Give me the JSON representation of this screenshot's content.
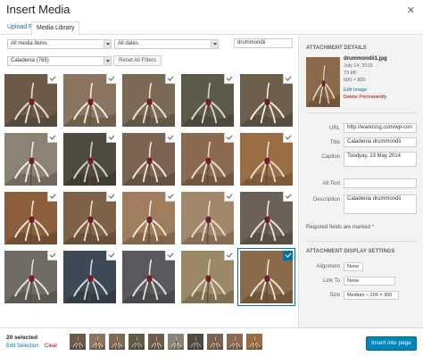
{
  "modal": {
    "title": "Insert Media",
    "tabs": [
      {
        "label": "Upload Files",
        "active": false
      },
      {
        "label": "Media Library",
        "active": true
      }
    ]
  },
  "filters": {
    "media_type": "All media items",
    "dates": "All dates",
    "category": "Caladenia (765)",
    "reset_label": "Reset All Filters",
    "search_value": "drummondii"
  },
  "grid": {
    "thumbnails": [
      {
        "bg": "#6b5a48",
        "fg": "#e8e2dc",
        "checked": true
      },
      {
        "bg": "#8a7560",
        "fg": "#f2ede6",
        "checked": true
      },
      {
        "bg": "#7b6a55",
        "fg": "#ece4da",
        "checked": true
      },
      {
        "bg": "#5c5a48",
        "fg": "#dcd8cf",
        "checked": true
      },
      {
        "bg": "#6d5e4c",
        "fg": "#f3eee8",
        "checked": true
      },
      {
        "bg": "#8a8374",
        "fg": "#f1ede8",
        "checked": true
      },
      {
        "bg": "#4f4a3f",
        "fg": "#d9d2c6",
        "checked": true
      },
      {
        "bg": "#7a6350",
        "fg": "#efe6dc",
        "checked": true
      },
      {
        "bg": "#8c6a50",
        "fg": "#e9dfd4",
        "checked": true
      },
      {
        "bg": "#9a6e45",
        "fg": "#eadbc9",
        "checked": true
      },
      {
        "bg": "#8b5f3c",
        "fg": "#f1e6d8",
        "checked": true
      },
      {
        "bg": "#7e6147",
        "fg": "#eae0d3",
        "checked": true
      },
      {
        "bg": "#a07c5c",
        "fg": "#f3ebe2",
        "checked": true
      },
      {
        "bg": "#a2876a",
        "fg": "#e8ddd0",
        "checked": true
      },
      {
        "bg": "#6c6156",
        "fg": "#ece6df",
        "checked": true
      },
      {
        "bg": "#6f6c66",
        "fg": "#e2dfdb",
        "checked": true
      },
      {
        "bg": "#3d4a55",
        "fg": "#d6d9dc",
        "checked": true
      },
      {
        "bg": "#5a5a5e",
        "fg": "#e4e4e6",
        "checked": true
      },
      {
        "bg": "#9a8866",
        "fg": "#e4dcc8",
        "checked": true
      },
      {
        "bg": "#8b6a4a",
        "fg": "#efe4d6",
        "checked": true,
        "active": true
      }
    ]
  },
  "details": {
    "heading": "Attachment Details",
    "filename": "drummondii1.jpg",
    "date": "July 14, 2015",
    "filesize": "73 kB",
    "dimensions": "600 × 800",
    "edit_link": "Edit Image",
    "delete_link": "Delete Permanently",
    "fields": {
      "url_label": "URL",
      "url_value": "http://wanoscg.com/wp-con",
      "title_label": "Title",
      "title_value": "Caladenia drummondii",
      "caption_label": "Caption",
      "caption_value": "Toodyay, 23 May 2014",
      "alt_label": "Alt Text",
      "alt_value": "",
      "description_label": "Description",
      "description_value": "Caladenia drummondii"
    },
    "required_note": "Required fields are marked",
    "required_star": "*"
  },
  "display_settings": {
    "heading": "Attachment Display Settings",
    "alignment_label": "Alignment",
    "alignment_value": "None",
    "link_label": "Link To",
    "link_value": "None",
    "size_label": "Size",
    "size_value": "Medium – 200 × 300"
  },
  "footer": {
    "selected_count": "20 selected",
    "edit_selection": "Edit Selection",
    "clear": "Clear",
    "insert_label": "Insert into page",
    "mini_count": 10
  },
  "colors": {
    "accent": "#0073aa",
    "primary_button": "#0085ba",
    "delete": "#a00000",
    "sidebar_bg": "#f3f3f3"
  }
}
